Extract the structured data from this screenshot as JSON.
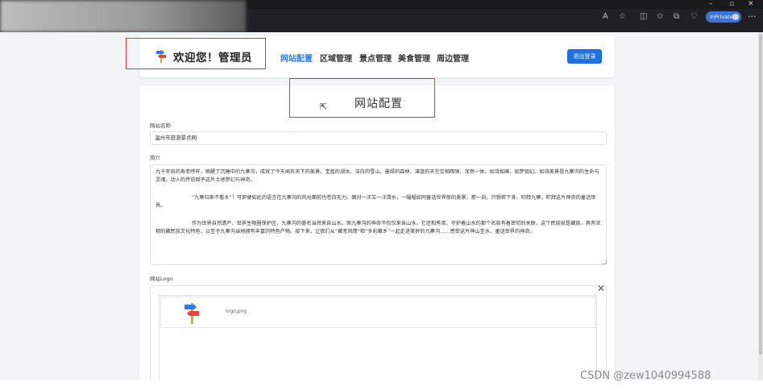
{
  "browser": {
    "inprivate_label": "InPrivate"
  },
  "header": {
    "title": "欢迎您！管理员",
    "nav": [
      {
        "label": "网站配置",
        "active": true
      },
      {
        "label": "区域管理",
        "active": false
      },
      {
        "label": "景点管理",
        "active": false
      },
      {
        "label": "美食管理",
        "active": false
      },
      {
        "label": "周边管理",
        "active": false
      }
    ],
    "logout_label": "退出登录"
  },
  "main": {
    "section_title": "网站配置",
    "site_name_label": "网站名称",
    "site_name_value": "温州市旅游景点网",
    "intro_label": "简介",
    "intro_paragraphs": [
      "九千年前的寿老呼吁，唤醒了沉睡中的九寨沟，成就了今天闻名天下的美景。宝蓝的湖水、洁白的雪山、墨绿的森林、湛蓝的天空交相辉映，浑然一体，如诗如画，如梦如幻。如诗美景是九寨沟的生命与灵魂，动人的传说赋予这片土地梦幻与神奇。",
      "“九寨归来不看水”！可即便如此的语言在九寨沟的风光面前也苍白无力。面对一汪又一汪清水，一幅幅如同童话世界般的美景，那一刻，只想俯下身，叩拜九寨，叩拜这片神奇的童话世界。",
      "作为世界自然遗产、世界生物圈保护区，九寨沟的盛名当然来自山水。但九寨沟的神奇不仅仅来自山水，它还和秀育、守护着山水的那个名族有着密切的关联，这个民族就是藏族，具有浓郁的藏民族文化特色，以至于九寨沟当地拥有丰富的特色产物。接下来，让我们从“藏羌风情”和“多彩藏乡”一起走进美好的九寨沟……感受这片神山圣水，童话世界的神奇。"
    ],
    "logo_label": "网站Logo",
    "logo_file_name": "logo.png"
  },
  "watermark": "CSDN @zew1040994588",
  "colors": {
    "accent": "#2f7be8",
    "button": "#1f6fe5",
    "highlight_box": "#e0353b"
  }
}
